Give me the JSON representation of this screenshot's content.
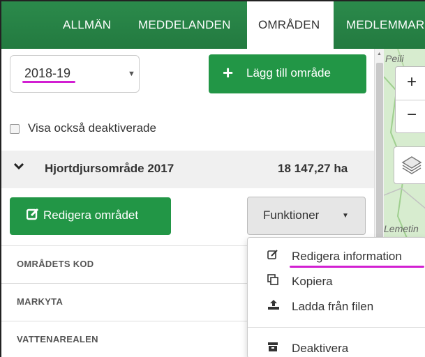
{
  "nav": {
    "tabs": [
      {
        "label": "ALLMÄN"
      },
      {
        "label": "MEDDELANDEN"
      },
      {
        "label": "OMRÅDEN",
        "active": true
      },
      {
        "label": "MEDLEMMAR"
      }
    ]
  },
  "season_select": {
    "value": "2018-19"
  },
  "add_area_button": {
    "label": "Lägg till område"
  },
  "show_deactivated": {
    "label": "Visa också deaktiverade",
    "checked": false
  },
  "area": {
    "name": "Hjortdjursområde 2017",
    "size": "18 147,27 ha"
  },
  "edit_area_button": {
    "label": "Redigera området"
  },
  "functions_button": {
    "label": "Funktioner"
  },
  "properties": {
    "rows": [
      {
        "label": "OMRÅDETS KOD"
      },
      {
        "label": "MARKYTA"
      },
      {
        "label": "VATTENAREALEN"
      }
    ]
  },
  "functions_menu": {
    "items": [
      {
        "label": "Redigera information",
        "icon": "edit-icon"
      },
      {
        "label": "Kopiera",
        "icon": "copy-icon"
      },
      {
        "label": "Ladda från filen",
        "icon": "upload-icon"
      },
      {
        "label": "Deaktivera",
        "icon": "archive-icon"
      }
    ]
  },
  "map": {
    "labels": [
      "Peili",
      "Lemetin"
    ],
    "zoom_in": "+",
    "zoom_out": "−"
  },
  "colors": {
    "nav_green": "#2b8a4b",
    "button_green": "#229646",
    "annotation_magenta": "#d21fd2"
  }
}
